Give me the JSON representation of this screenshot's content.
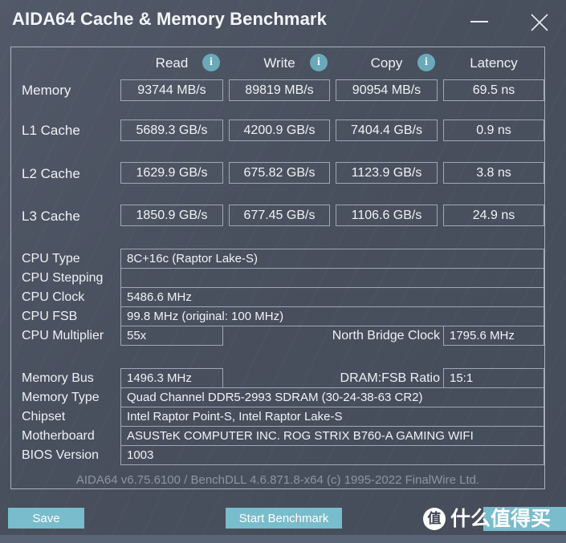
{
  "window": {
    "title": "AIDA64 Cache & Memory Benchmark",
    "minimize_label": "minimize",
    "close_label": "close"
  },
  "benchmark": {
    "columns": [
      "Read",
      "Write",
      "Copy",
      "Latency"
    ],
    "info_icon_label": "i",
    "rows": [
      {
        "label": "Memory",
        "read": "93744 MB/s",
        "write": "89819 MB/s",
        "copy": "90954 MB/s",
        "latency": "69.5 ns"
      },
      {
        "label": "L1 Cache",
        "read": "5689.3 GB/s",
        "write": "4200.9 GB/s",
        "copy": "7404.4 GB/s",
        "latency": "0.9 ns"
      },
      {
        "label": "L2 Cache",
        "read": "1629.9 GB/s",
        "write": "675.82 GB/s",
        "copy": "1123.9 GB/s",
        "latency": "3.8 ns"
      },
      {
        "label": "L3 Cache",
        "read": "1850.9 GB/s",
        "write": "677.45 GB/s",
        "copy": "1106.6 GB/s",
        "latency": "24.9 ns"
      }
    ]
  },
  "cpu_info": {
    "cpu_type_label": "CPU Type",
    "cpu_type_value": "8C+16c   (Raptor Lake-S)",
    "cpu_stepping_label": "CPU Stepping",
    "cpu_stepping_value": "",
    "cpu_clock_label": "CPU Clock",
    "cpu_clock_value": "5486.6 MHz",
    "cpu_fsb_label": "CPU FSB",
    "cpu_fsb_value": "99.8 MHz  (original: 100 MHz)",
    "cpu_multiplier_label": "CPU Multiplier",
    "cpu_multiplier_value": "55x",
    "north_bridge_label": "North Bridge Clock",
    "north_bridge_value": "1795.6 MHz"
  },
  "memory_info": {
    "memory_bus_label": "Memory Bus",
    "memory_bus_value": "1496.3 MHz",
    "dram_fsb_label": "DRAM:FSB Ratio",
    "dram_fsb_value": "15:1",
    "memory_type_label": "Memory Type",
    "memory_type_value": "Quad Channel DDR5-2993 SDRAM  (30-24-38-63 CR2)",
    "chipset_label": "Chipset",
    "chipset_value": "Intel Raptor Point-S, Intel Raptor Lake-S",
    "motherboard_label": "Motherboard",
    "motherboard_value": "ASUSTeK COMPUTER INC. ROG STRIX B760-A GAMING WIFI",
    "bios_label": "BIOS Version",
    "bios_value": "1003"
  },
  "footer": {
    "version_text": "AIDA64 v6.75.6100 / BenchDLL 4.6.871.8-x64  (c) 1995-2022 FinalWire Ltd.",
    "save_label": "Save",
    "start_label": "Start Benchmark"
  },
  "watermark": {
    "badge_text": "值",
    "text": "什么值得买"
  },
  "colors": {
    "background": "#4b5260",
    "accent": "#79bccb",
    "info_icon": "#6aa9ba",
    "border": "#9fa8b4",
    "text": "#f0f3f7",
    "muted_text": "#8d96a3",
    "bottom_strip": "#5a6477"
  }
}
